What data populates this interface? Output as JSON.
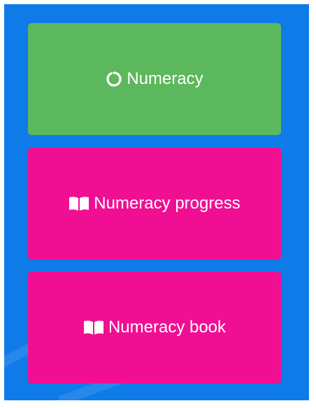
{
  "colors": {
    "panel_bg": "#0f7be8",
    "numeracy_tile": "#5cb85c",
    "progress_tile": "#f00f92",
    "book_tile": "#f00f92",
    "text": "#ffffff"
  },
  "tiles": [
    {
      "label": "Numeracy",
      "icon": "circle-notch-icon"
    },
    {
      "label": "Numeracy progress",
      "icon": "open-book-icon"
    },
    {
      "label": "Numeracy book",
      "icon": "open-book-icon"
    }
  ]
}
